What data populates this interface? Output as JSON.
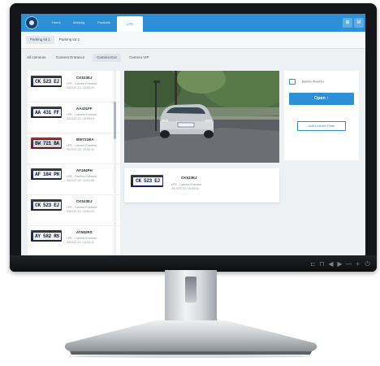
{
  "nav": {
    "items": [
      {
        "label": "Home",
        "active": false
      },
      {
        "label": "Marking",
        "active": false
      },
      {
        "label": "Products",
        "active": false
      },
      {
        "label": "LPR",
        "active": true
      }
    ]
  },
  "topbar_buttons": [
    "⊞",
    "M"
  ],
  "parking_tabs": [
    {
      "label": "Parking lot 1",
      "active": true
    },
    {
      "label": "Parking lot 2",
      "active": false
    }
  ],
  "camera_tabs": [
    {
      "label": "All cameras",
      "active": false
    },
    {
      "label": "Camera Entrance",
      "active": false
    },
    {
      "label": "Camera Exit",
      "active": true
    },
    {
      "label": "Camera VIP",
      "active": false
    }
  ],
  "list": [
    {
      "plate": "CK 523 EJ",
      "code": "CK523EJ",
      "sub1": "LPR - Camera Entrance",
      "sub2": "2019.07.22 / 10:59:20",
      "red": false
    },
    {
      "plate": "AA 431 FF",
      "code": "AA431FF",
      "sub1": "LPR - Camera Entrance",
      "sub2": "2019.07.22 / 10:59:04",
      "red": false
    },
    {
      "plate": "BW 721 BA",
      "code": "BW721BA",
      "sub1": "LPR - Camera Entrance",
      "sub2": "2019.07.22 / 10:52:20",
      "red": true
    },
    {
      "plate": "AF 184 PH",
      "code": "AF184PH",
      "sub1": "LPR - Camera Entrance",
      "sub2": "2019.07.22 / 10:51:55",
      "red": false
    },
    {
      "plate": "CK 523 EJ",
      "code": "CK523EJ",
      "sub1": "LPR - Camera Entrance",
      "sub2": "2019.07.22 / 10:51:20",
      "red": false
    },
    {
      "plate": "AY 582 RS",
      "code": "AY582RS",
      "sub1": "LPR - Camera Entrance",
      "sub2": "2019.07.22 / 10:50:11",
      "red": false
    }
  ],
  "detail": {
    "plate": "CK 523 EJ",
    "code": "CK523EJ",
    "sub1": "LPR - Camera Entrance",
    "sub2": "2019.07.22 / 10:59:20"
  },
  "right_panel": {
    "barrier_label": "Barrier #barrier",
    "open_label": "Open ↑",
    "add_label": "Add License Plate"
  },
  "bezel_controls": [
    "⊏",
    "⊓",
    "◀",
    "▶",
    "—",
    "+",
    "⏻"
  ],
  "colors": {
    "accent": "#2d8fd6",
    "bezel": "#131518"
  }
}
